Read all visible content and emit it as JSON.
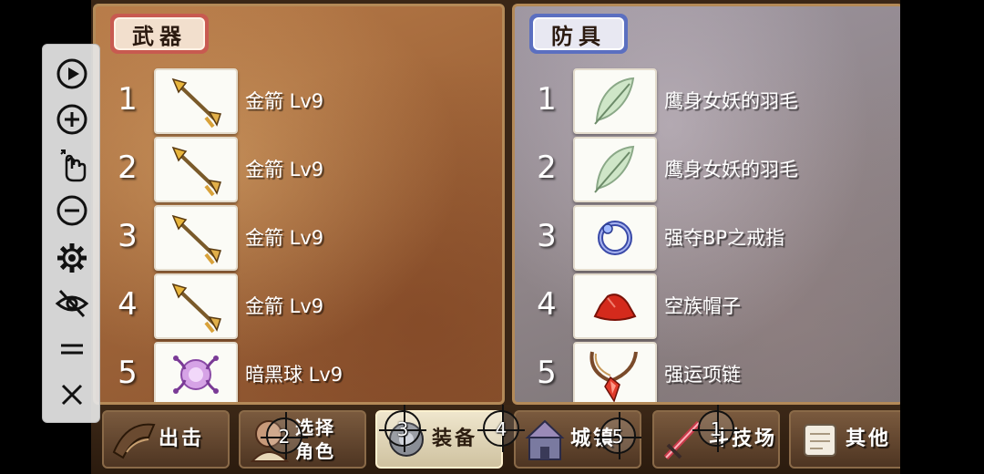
{
  "weapons_panel": {
    "tab_label": "武器",
    "items": [
      {
        "num": "1",
        "name": "金箭 Lv9",
        "icon": "golden-arrow-icon"
      },
      {
        "num": "2",
        "name": "金箭 Lv9",
        "icon": "golden-arrow-icon"
      },
      {
        "num": "3",
        "name": "金箭 Lv9",
        "icon": "golden-arrow-icon"
      },
      {
        "num": "4",
        "name": "金箭 Lv9",
        "icon": "golden-arrow-icon"
      },
      {
        "num": "5",
        "name": "暗黑球 Lv9",
        "icon": "dark-orb-icon"
      }
    ]
  },
  "armor_panel": {
    "tab_label": "防具",
    "items": [
      {
        "num": "1",
        "name": "鹰身女妖的羽毛",
        "icon": "feather-icon"
      },
      {
        "num": "2",
        "name": "鹰身女妖的羽毛",
        "icon": "feather-icon"
      },
      {
        "num": "3",
        "name": "强夺BP之戒指",
        "icon": "ring-icon"
      },
      {
        "num": "4",
        "name": "空族帽子",
        "icon": "red-hat-icon"
      },
      {
        "num": "5",
        "name": "强运项链",
        "icon": "necklace-icon"
      }
    ]
  },
  "bottom_nav": {
    "items": [
      {
        "label": "出击",
        "icon": "sortie-icon"
      },
      {
        "label_line1": "选择",
        "label_line2": "角色",
        "icon": "character-select-icon"
      },
      {
        "label": "装备",
        "icon": "equipment-icon",
        "active": true
      },
      {
        "label": "城镇",
        "icon": "town-icon"
      },
      {
        "label": "斗技场",
        "icon": "arena-sword-icon"
      },
      {
        "label": "其他",
        "icon": "other-scroll-icon"
      }
    ]
  },
  "markers": [
    "2",
    "3",
    "4",
    "5",
    "1"
  ],
  "toolbar": {
    "buttons": [
      "play-icon",
      "zoom-in-icon",
      "tap-gesture-icon",
      "zoom-out-icon",
      "gear-icon",
      "hide-icon",
      "drag-handle-icon",
      "close-icon"
    ]
  },
  "colors": {
    "weapon_tab": "#c85a50",
    "armor_tab": "#5b6fc0",
    "active_nav": "#efe6cd"
  }
}
